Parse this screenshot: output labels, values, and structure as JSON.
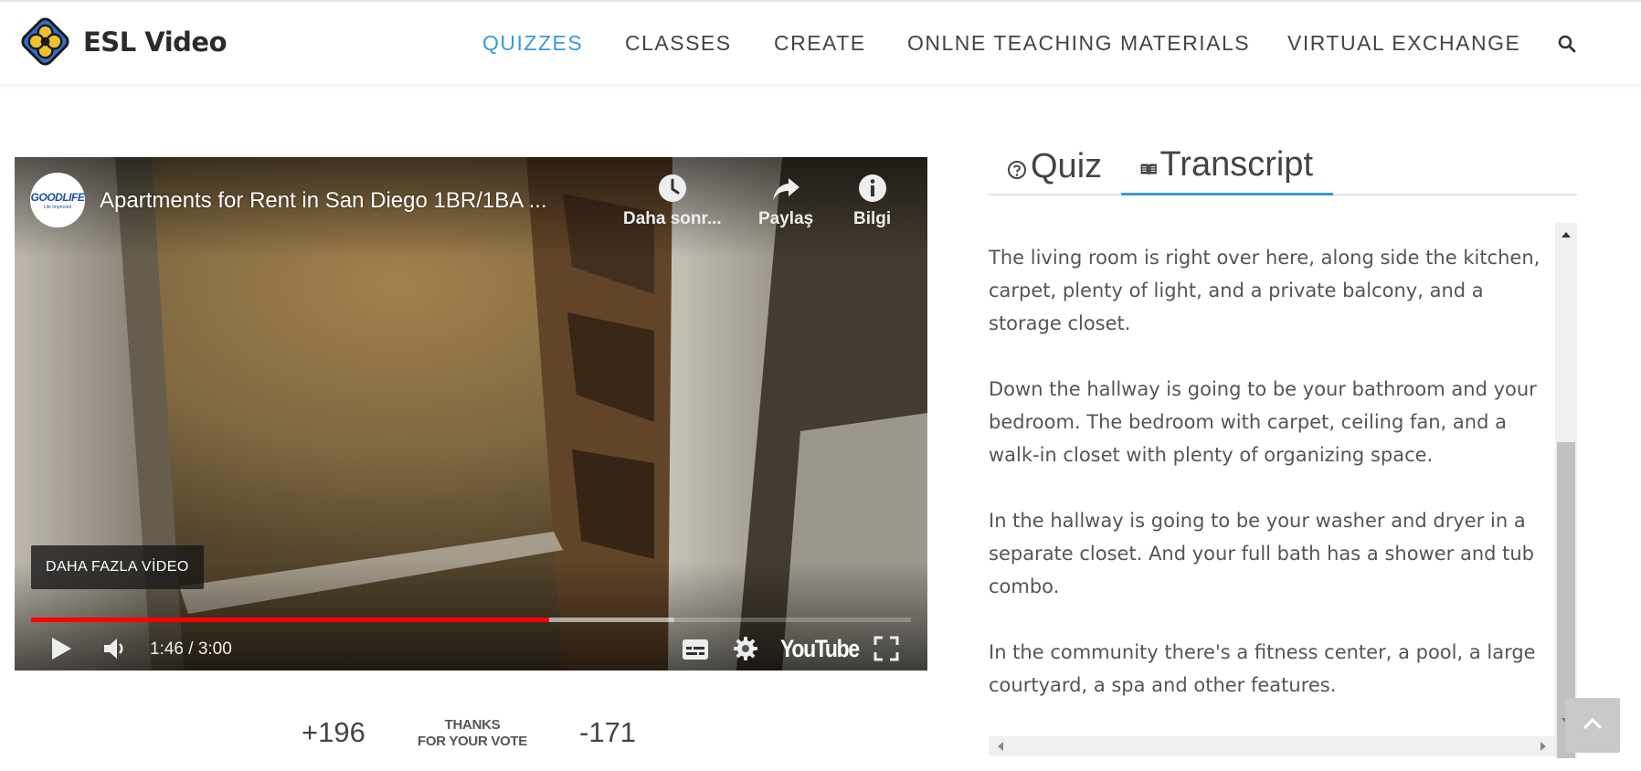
{
  "brand": {
    "name": "ESL Video",
    "logo_icon": "eslvideo-flower-logo"
  },
  "nav": {
    "items": [
      {
        "label": "QUIZZES",
        "active": true
      },
      {
        "label": "CLASSES",
        "active": false
      },
      {
        "label": "CREATE",
        "active": false
      },
      {
        "label": "ONLNE TEACHING MATERIALS",
        "active": false
      },
      {
        "label": "VIRTUAL EXCHANGE",
        "active": false
      }
    ],
    "search_icon": "search-icon"
  },
  "video": {
    "channel_logo_text": "GOODLIFE",
    "channel_logo_tagline": "Life Improved",
    "title": "Apartments for Rent in San Diego 1BR/1BA ...",
    "actions": [
      {
        "label": "Daha sonr...",
        "icon": "clock-icon"
      },
      {
        "label": "Paylaş",
        "icon": "share-icon"
      },
      {
        "label": "Bilgi",
        "icon": "info-icon"
      }
    ],
    "more_videos_label": "DAHA FAZLA VİDEO",
    "time_display": "1:46 / 3:00",
    "played_fraction": 0.589,
    "buffered_fraction": 0.731,
    "youtube_label": "YouTube",
    "progress_color": "#ff0000"
  },
  "votes": {
    "up": "+196",
    "message_line1": "THANKS",
    "message_line2": "FOR YOUR VOTE",
    "down": "-171"
  },
  "tabs": [
    {
      "label": "Quiz",
      "icon": "question-circle-icon",
      "active": false
    },
    {
      "label": "Transcript",
      "icon": "book-icon",
      "active": true
    }
  ],
  "transcript": {
    "paragraphs": [
      "The living room is right over here, along side the kitchen, carpet, plenty of light, and a private balcony, and a storage closet.",
      "Down the hallway is going to be your bathroom and your bedroom. The bedroom with carpet, ceiling fan, and a walk-in closet with plenty of organizing space.",
      "In the hallway is going to be your washer and dryer in a separate closet. And your full bath has a shower and tub combo.",
      "In the community there's a fitness center, a pool, a large courtyard, a spa and other features."
    ]
  },
  "colors": {
    "accent": "#3a9ad9",
    "text": "#555555"
  }
}
